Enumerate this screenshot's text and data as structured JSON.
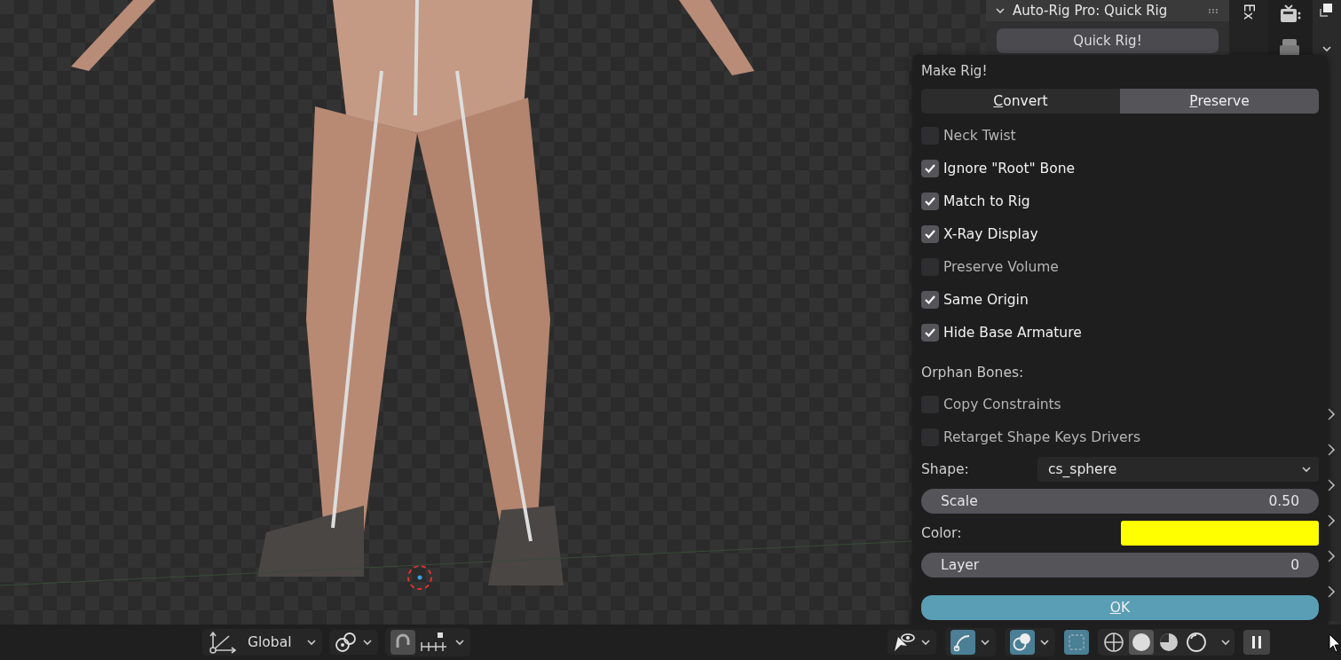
{
  "side_panel": {
    "header": "Auto-Rig Pro: Quick Rig",
    "tab": "Ex",
    "button": "Quick Rig!"
  },
  "dialog": {
    "title": "Make Rig!",
    "modes": [
      {
        "label": "Convert",
        "selected": false
      },
      {
        "label": "Preserve",
        "selected": true
      }
    ],
    "options": [
      {
        "label": "Neck Twist",
        "checked": false
      },
      {
        "label": "Ignore \"Root\" Bone",
        "checked": true
      },
      {
        "label": "Match to Rig",
        "checked": true
      },
      {
        "label": "X-Ray Display",
        "checked": true
      },
      {
        "label": "Preserve Volume",
        "checked": false
      },
      {
        "label": "Same Origin",
        "checked": true
      },
      {
        "label": "Hide Base Armature",
        "checked": true
      }
    ],
    "orphan_label": "Orphan Bones:",
    "orphan_options": [
      {
        "label": "Copy Constraints",
        "checked": false
      },
      {
        "label": "Retarget Shape Keys Drivers",
        "checked": false
      }
    ],
    "shape": {
      "label": "Shape:",
      "value": "cs_sphere"
    },
    "scale": {
      "label": "Scale",
      "value": "0.50"
    },
    "color": {
      "label": "Color:",
      "color": "#ffff00"
    },
    "layer": {
      "label": "Layer",
      "value": "0"
    },
    "ok": "OK"
  },
  "viewport_header": {
    "orientation": "Global",
    "snap": {
      "on": true
    },
    "gizmos": {
      "on": true
    },
    "overlays": {
      "on": true
    },
    "xray": {
      "on": true
    },
    "shading_modes": [
      {
        "selected": false
      },
      {
        "selected": true
      },
      {
        "selected": false
      },
      {
        "selected": false
      }
    ]
  }
}
